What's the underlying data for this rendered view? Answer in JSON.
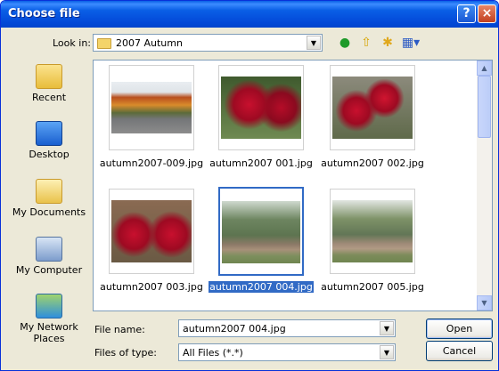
{
  "window": {
    "title": "Choose file",
    "help_glyph": "?",
    "close_glyph": "×"
  },
  "lookin": {
    "label": "Look in:",
    "value": "2007 Autumn"
  },
  "toolbar": {
    "icons": [
      "back-icon",
      "up-folder-icon",
      "new-folder-icon",
      "views-menu-icon"
    ]
  },
  "places": [
    {
      "label": "Recent",
      "icon": "recent-folder-icon"
    },
    {
      "label": "Desktop",
      "icon": "desktop-icon"
    },
    {
      "label": "My Documents",
      "icon": "my-documents-icon"
    },
    {
      "label": "My Computer",
      "icon": "my-computer-icon"
    },
    {
      "label": "My Network Places",
      "icon": "network-places-icon"
    }
  ],
  "files": [
    {
      "name": "autumn2007-009.jpg",
      "thumb": "road",
      "selected": false
    },
    {
      "name": "autumn2007 001.jpg",
      "thumb": "roses",
      "selected": false
    },
    {
      "name": "autumn2007 002.jpg",
      "thumb": "roses",
      "selected": false
    },
    {
      "name": "autumn2007 003.jpg",
      "thumb": "roses",
      "selected": false
    },
    {
      "name": "autumn2007 004.jpg",
      "thumb": "yard",
      "selected": true
    },
    {
      "name": "autumn2007 005.jpg",
      "thumb": "yard",
      "selected": false
    }
  ],
  "filename": {
    "label": "File name:",
    "value": "autumn2007 004.jpg"
  },
  "filetype": {
    "label": "Files of type:",
    "value": "All Files (*.*)"
  },
  "buttons": {
    "open": "Open",
    "cancel": "Cancel"
  },
  "colors": {
    "title_bar": "#0a5fe6",
    "selection": "#316ac5",
    "dialog_bg": "#ece9d8"
  }
}
